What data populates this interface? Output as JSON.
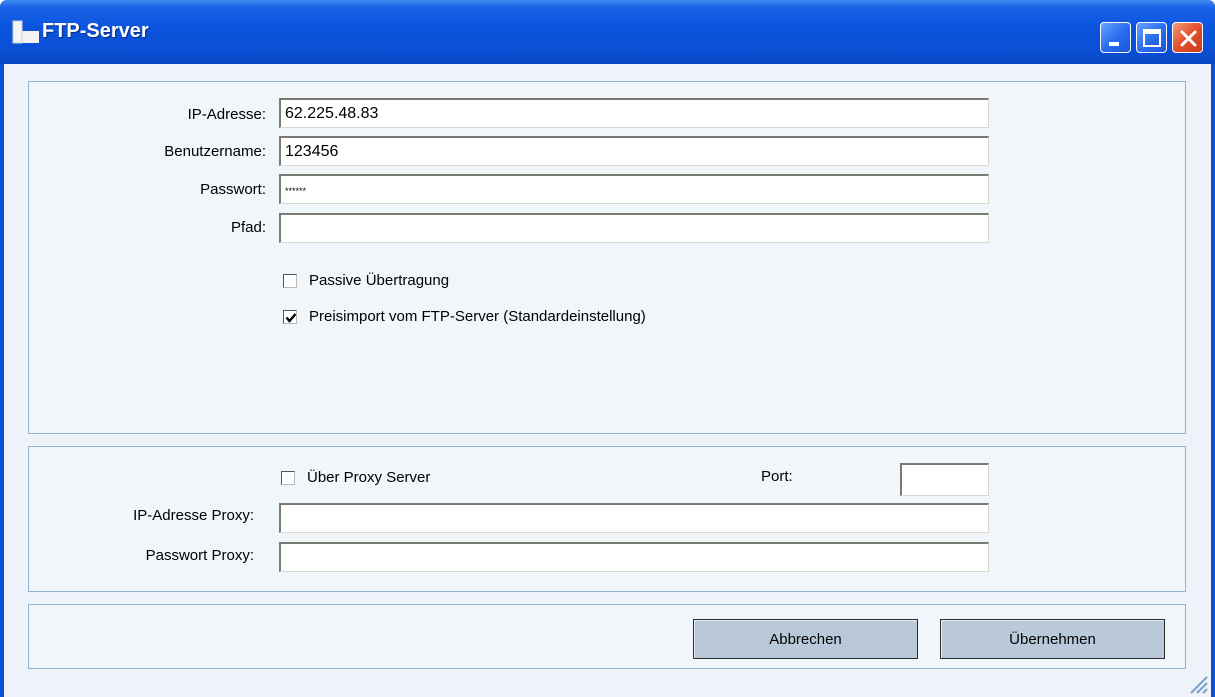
{
  "window": {
    "title": "FTP-Server",
    "icon": "app-document-icon",
    "colors": {
      "titlebar": "#0a50d8",
      "client": "#edf3f9",
      "group_border": "#8fb4d6",
      "button": "#b9c9da"
    }
  },
  "server": {
    "ip_label": "IP-Adresse:",
    "ip_value": "62.225.48.83",
    "user_label": "Benutzername:",
    "user_value": "123456",
    "password_label": "Passwort:",
    "password_value": "******",
    "path_label": "Pfad:",
    "path_value": "",
    "passive_label": "Passive Übertragung",
    "passive_checked": false,
    "preisimport_label": "Preisimport  vom  FTP-Server  (Standardeinstellung)",
    "preisimport_checked": true
  },
  "proxy": {
    "use_proxy_label": "Über Proxy Server",
    "use_proxy_checked": false,
    "port_label": "Port:",
    "port_value": "",
    "ip_label": "IP-Adresse Proxy:",
    "ip_value": "",
    "password_label": "Passwort Proxy:",
    "password_value": ""
  },
  "actions": {
    "cancel_label": "Abbrechen",
    "apply_label": "Übernehmen"
  }
}
